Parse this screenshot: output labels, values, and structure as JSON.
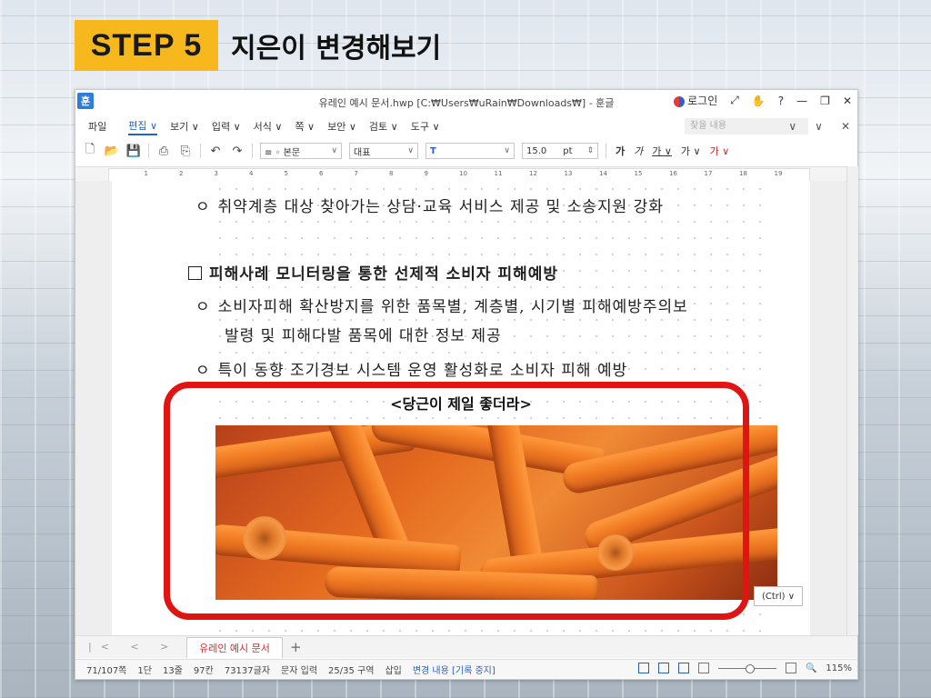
{
  "slide": {
    "step_label": "STEP 5",
    "title": "지은이 변경해보기",
    "badge_color": "#f6b81d",
    "highlight_color": "#e11414"
  },
  "window": {
    "app_icon": "훈",
    "title": "유레인 예시 문서.hwp [C:₩Users₩uRain₩Downloads₩] - 훈글",
    "login_label": "로그인",
    "title_buttons": [
      "⤢",
      "✋",
      "?",
      "—",
      "❐",
      "✕"
    ]
  },
  "menu": {
    "items": [
      "파일",
      "편집 ∨",
      "보기 ∨",
      "입력 ∨",
      "서식 ∨",
      "쪽 ∨",
      "보안 ∨",
      "검토 ∨",
      "도구 ∨"
    ],
    "active_index": 1,
    "search_placeholder": "찾을 내용",
    "right_icons": [
      "∨",
      "∨",
      "✕"
    ]
  },
  "toolbar": {
    "style_value": "≡ ◦ 본문",
    "font_value": "대표",
    "font_name_value": "T",
    "size_value": "15.0",
    "size_unit": "pt",
    "text_styles": [
      "가",
      "가",
      "가 ∨",
      "가 ∨",
      "가 ∨"
    ]
  },
  "ruler": {
    "numbers": [
      "1",
      "2",
      "3",
      "4",
      "5",
      "6",
      "7",
      "8",
      "9",
      "10",
      "11",
      "12",
      "13",
      "14",
      "15",
      "16",
      "17",
      "18",
      "19"
    ]
  },
  "document": {
    "line1": "취약계층 대상 찾아가는 상담·교육 서비스 제공 및 소송지원 강화",
    "heading": "피해사례 모니터링을 통한 선제적 소비자 피해예방",
    "line2": "소비자피해 확산방지를 위한 품목별, 계층별, 시기별 피해예방주의보",
    "line3": "발령 및 피해다발 품목에 대한 정보 제공",
    "line4": "특이 동향 조기경보 시스템 운영 활성화로 소비자 피해 예방",
    "bullet": "ㅇ",
    "caption": "<당근이 제일 좋더라>",
    "paste_badge": "(Ctrl) ∨"
  },
  "tabs": {
    "nav": "|< < > >|",
    "active_tab": "유레인 예시 문서",
    "add": "+"
  },
  "status": {
    "items": [
      "71/107쪽",
      "1단",
      "13줄",
      "97칸",
      "73137글자",
      "문자 입력",
      "25/35 구역",
      "삽입"
    ],
    "track_changes": "변경 내용 [기록 중지]",
    "zoom": "115%"
  }
}
